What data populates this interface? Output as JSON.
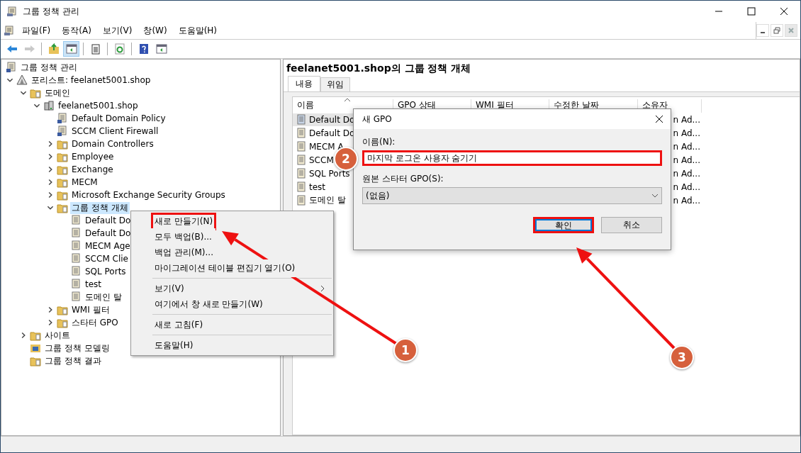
{
  "window": {
    "title": "그룹 정책 관리"
  },
  "menu": [
    "파일(F)",
    "동작(A)",
    "보기(V)",
    "창(W)",
    "도움말(H)"
  ],
  "toolbar": [
    {
      "kind": "back",
      "disabled": false,
      "pressed": false
    },
    {
      "kind": "forward",
      "disabled": true,
      "pressed": false
    },
    {
      "kind": "sep"
    },
    {
      "kind": "up",
      "disabled": false,
      "pressed": false
    },
    {
      "kind": "tree",
      "disabled": false,
      "pressed": true
    },
    {
      "kind": "sep"
    },
    {
      "kind": "export",
      "disabled": false,
      "pressed": false
    },
    {
      "kind": "sep"
    },
    {
      "kind": "refresh",
      "disabled": false,
      "pressed": false
    },
    {
      "kind": "sep"
    },
    {
      "kind": "help",
      "disabled": false,
      "pressed": false
    },
    {
      "kind": "pane",
      "disabled": false,
      "pressed": false
    }
  ],
  "tree": [
    {
      "label": "그룹 정책 관리",
      "kind": "root",
      "selected": false,
      "children": [
        {
          "label": "포리스트: feelanet5001.shop",
          "kind": "forest",
          "expanded": true,
          "selected": false,
          "children": [
            {
              "label": "도메인",
              "kind": "domains",
              "expanded": true,
              "selected": false,
              "children": [
                {
                  "label": "feelanet5001.shop",
                  "kind": "domain",
                  "expanded": true,
                  "selected": false,
                  "children": [
                    {
                      "label": "Default Domain Policy",
                      "kind": "link",
                      "selected": false
                    },
                    {
                      "label": "SCCM Client Firewall",
                      "kind": "link",
                      "selected": false
                    },
                    {
                      "label": "Domain Controllers",
                      "kind": "ou",
                      "expanded": false,
                      "selected": false
                    },
                    {
                      "label": "Employee",
                      "kind": "ou",
                      "expanded": false,
                      "selected": false
                    },
                    {
                      "label": "Exchange",
                      "kind": "ou",
                      "expanded": false,
                      "selected": false
                    },
                    {
                      "label": "MECM",
                      "kind": "ou",
                      "expanded": false,
                      "selected": false
                    },
                    {
                      "label": "Microsoft Exchange Security Groups",
                      "kind": "ou",
                      "expanded": false,
                      "selected": false
                    },
                    {
                      "label": "그룹 정책 개체",
                      "kind": "gpofolder",
                      "expanded": true,
                      "selected": true,
                      "children": [
                        {
                          "label": "Default Do",
                          "kind": "gpo",
                          "selected": false
                        },
                        {
                          "label": "Default Do",
                          "kind": "gpo",
                          "selected": false
                        },
                        {
                          "label": "MECM Age",
                          "kind": "gpo",
                          "selected": false
                        },
                        {
                          "label": "SCCM Clie",
                          "kind": "gpo",
                          "selected": false
                        },
                        {
                          "label": "SQL Ports",
                          "kind": "gpo",
                          "selected": false
                        },
                        {
                          "label": "test",
                          "kind": "gpo",
                          "selected": false
                        },
                        {
                          "label": "도메인 탈",
                          "kind": "gpo",
                          "selected": false
                        }
                      ]
                    },
                    {
                      "label": "WMI 필터",
                      "kind": "wmi",
                      "expanded": false,
                      "selected": false
                    },
                    {
                      "label": "스타터 GPO",
                      "kind": "starter",
                      "expanded": false,
                      "selected": false
                    }
                  ]
                }
              ]
            },
            {
              "label": "사이트",
              "kind": "sites",
              "expanded": false,
              "selected": false
            },
            {
              "label": "그룹 정책 모델링",
              "kind": "modeling",
              "selected": false
            },
            {
              "label": "그룹 정책 결과",
              "kind": "results",
              "selected": false
            }
          ]
        }
      ]
    }
  ],
  "context_menu": [
    {
      "kind": "item",
      "label": "새로 만들기(N)",
      "highlighted": true
    },
    {
      "kind": "item",
      "label": "모두 백업(B)...",
      "highlighted": false
    },
    {
      "kind": "item",
      "label": "백업 관리(M)...",
      "highlighted": false
    },
    {
      "kind": "item",
      "label": "마이그레이션 테이블 편집기 열기(O)",
      "highlighted": false
    },
    {
      "kind": "separator"
    },
    {
      "kind": "submenu",
      "label": "보기(V)",
      "highlighted": false
    },
    {
      "kind": "item",
      "label": "여기에서 창 새로 만들기(W)",
      "highlighted": false
    },
    {
      "kind": "separator"
    },
    {
      "kind": "item",
      "label": "새로 고침(F)",
      "highlighted": false
    },
    {
      "kind": "separator"
    },
    {
      "kind": "item",
      "label": "도움말(H)",
      "highlighted": false
    }
  ],
  "content": {
    "heading": "feelanet5001.shop의 그룹 정책 개체",
    "tabs": [
      {
        "label": "내용",
        "selected": true
      },
      {
        "label": "위임",
        "selected": false
      }
    ],
    "columns": [
      "이름",
      "GPO 상태",
      "WMI 필터",
      "수정한 날짜",
      "소유자"
    ],
    "rows": [
      {
        "name": "Default Do",
        "owner": "n Ad...",
        "selected": true
      },
      {
        "name": "Default Do",
        "owner": "n Ad...",
        "selected": false
      },
      {
        "name": "MECM A",
        "owner": "n Ad...",
        "selected": false
      },
      {
        "name": "SCCM",
        "owner": "n Ad...",
        "selected": false
      },
      {
        "name": "SQL Ports",
        "owner": "n Ad...",
        "selected": false
      },
      {
        "name": "test",
        "owner": "n Ad...",
        "selected": false
      },
      {
        "name": "도메인 탈",
        "owner": "n Ad...",
        "selected": false
      }
    ]
  },
  "dialog": {
    "title": "새 GPO",
    "name_label": "이름(N):",
    "name_value": "마지막 로그온 사용자 숨기기",
    "name_highlighted": true,
    "starter_label": "원본 스타터 GPO(S):",
    "starter_value": "(없음)",
    "buttons": [
      {
        "label": "확인",
        "highlighted": true
      },
      {
        "label": "취소",
        "highlighted": false
      }
    ]
  },
  "steps": [
    "1",
    "2",
    "3"
  ]
}
